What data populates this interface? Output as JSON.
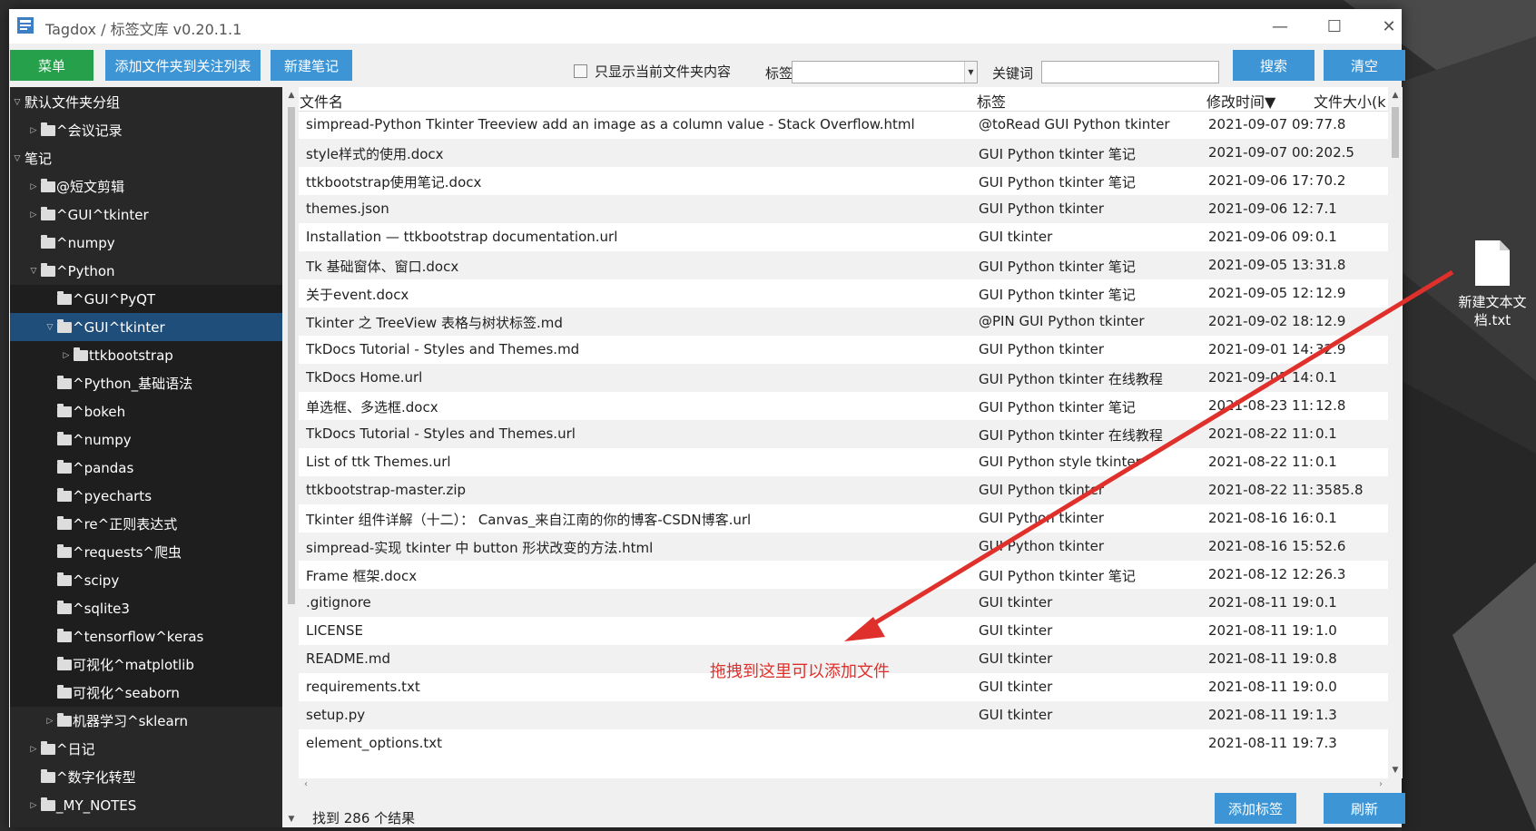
{
  "window": {
    "title": "Tagdox / 标签文库 v0.20.1.1",
    "controls": {
      "minimize": "—",
      "maximize": "☐",
      "close": "✕"
    }
  },
  "toolbar": {
    "menu": "菜单",
    "add_folder": "添加文件夹到关注列表",
    "new_note": "新建笔记",
    "only_current_folder": "只显示当前文件夹内容",
    "only_current_folder_checked": false,
    "tag_label": "标签",
    "tag_value": "",
    "keyword_label": "关键词",
    "keyword_value": "",
    "search": "搜索",
    "clear": "清空"
  },
  "tree": [
    {
      "label": "默认文件夹分组",
      "level": 0,
      "toggle": "open",
      "folder": false
    },
    {
      "label": "^会议记录",
      "level": 2,
      "toggle": "closed",
      "folder": true
    },
    {
      "label": "笔记",
      "level": 0,
      "toggle": "open",
      "folder": false
    },
    {
      "label": "@短文剪辑",
      "level": 2,
      "toggle": "closed",
      "folder": true
    },
    {
      "label": "^GUI^tkinter",
      "level": 2,
      "toggle": "closed",
      "folder": true
    },
    {
      "label": "^numpy",
      "level": 2,
      "toggle": "none",
      "folder": true
    },
    {
      "label": "^Python",
      "level": 2,
      "toggle": "open",
      "folder": true
    },
    {
      "label": "^GUI^PyQT",
      "level": 4,
      "toggle": "none",
      "folder": true
    },
    {
      "label": "^GUI^tkinter",
      "level": 4,
      "toggle": "open",
      "folder": true,
      "selected": true
    },
    {
      "label": "ttkbootstrap",
      "level": 6,
      "toggle": "closed",
      "folder": true
    },
    {
      "label": "^Python_基础语法",
      "level": 4,
      "toggle": "none",
      "folder": true
    },
    {
      "label": "^bokeh",
      "level": 4,
      "toggle": "none",
      "folder": true
    },
    {
      "label": "^numpy",
      "level": 4,
      "toggle": "none",
      "folder": true
    },
    {
      "label": "^pandas",
      "level": 4,
      "toggle": "none",
      "folder": true
    },
    {
      "label": "^pyecharts",
      "level": 4,
      "toggle": "none",
      "folder": true
    },
    {
      "label": "^re^正则表达式",
      "level": 4,
      "toggle": "none",
      "folder": true
    },
    {
      "label": "^requests^爬虫",
      "level": 4,
      "toggle": "none",
      "folder": true
    },
    {
      "label": "^scipy",
      "level": 4,
      "toggle": "none",
      "folder": true
    },
    {
      "label": "^sqlite3",
      "level": 4,
      "toggle": "none",
      "folder": true
    },
    {
      "label": "^tensorflow^keras",
      "level": 4,
      "toggle": "none",
      "folder": true
    },
    {
      "label": "可视化^matplotlib",
      "level": 4,
      "toggle": "none",
      "folder": true
    },
    {
      "label": "可视化^seaborn",
      "level": 4,
      "toggle": "none",
      "folder": true
    },
    {
      "label": "机器学习^sklearn",
      "level": 4,
      "toggle": "closed",
      "folder": true
    },
    {
      "label": "^日记",
      "level": 2,
      "toggle": "closed",
      "folder": true
    },
    {
      "label": "^数字化转型",
      "level": 2,
      "toggle": "none",
      "folder": true
    },
    {
      "label": "_MY_NOTES",
      "level": 2,
      "toggle": "closed",
      "folder": true
    }
  ],
  "columns": {
    "name": "文件名",
    "tags": "标签",
    "modified": "修改时间▼",
    "size": "文件大小(k"
  },
  "files": [
    {
      "name": "simpread-Python Tkinter Treeview add an image as a column value - Stack Overflow.html",
      "tags": "@toRead GUI Python tkinter",
      "modified": "2021-09-07 09:",
      "size": "77.8"
    },
    {
      "name": "style样式的使用.docx",
      "tags": "GUI Python tkinter 笔记",
      "modified": "2021-09-07 00:",
      "size": "202.5"
    },
    {
      "name": "ttkbootstrap使用笔记.docx",
      "tags": "GUI Python tkinter 笔记",
      "modified": "2021-09-06 17:",
      "size": "70.2"
    },
    {
      "name": "themes.json",
      "tags": "GUI Python tkinter",
      "modified": "2021-09-06 12:",
      "size": "7.1"
    },
    {
      "name": "Installation — ttkbootstrap documentation.url",
      "tags": "GUI tkinter",
      "modified": "2021-09-06 09:",
      "size": "0.1"
    },
    {
      "name": "Tk 基础窗体、窗口.docx",
      "tags": "GUI Python tkinter 笔记",
      "modified": "2021-09-05 13:",
      "size": "31.8"
    },
    {
      "name": "关于event.docx",
      "tags": "GUI Python tkinter 笔记",
      "modified": "2021-09-05 12:",
      "size": "12.9"
    },
    {
      "name": "Tkinter 之 TreeView 表格与树状标签.md",
      "tags": "@PIN GUI Python tkinter",
      "modified": "2021-09-02 18:",
      "size": "12.9"
    },
    {
      "name": "TkDocs Tutorial - Styles and Themes.md",
      "tags": "GUI Python tkinter",
      "modified": "2021-09-01 14:",
      "size": "32.9"
    },
    {
      "name": "TkDocs Home.url",
      "tags": "GUI Python tkinter 在线教程",
      "modified": "2021-09-01 14:",
      "size": "0.1"
    },
    {
      "name": "单选框、多选框.docx",
      "tags": "GUI Python tkinter 笔记",
      "modified": "2021-08-23 11:",
      "size": "12.8"
    },
    {
      "name": "TkDocs Tutorial - Styles and Themes.url",
      "tags": "GUI Python tkinter 在线教程",
      "modified": "2021-08-22 11:",
      "size": "0.1"
    },
    {
      "name": "List of ttk Themes.url",
      "tags": "GUI Python style tkinter",
      "modified": "2021-08-22 11:",
      "size": "0.1"
    },
    {
      "name": "ttkbootstrap-master.zip",
      "tags": "GUI Python tkinter",
      "modified": "2021-08-22 11:",
      "size": "3585.8"
    },
    {
      "name": "Tkinter 组件详解（十二）： Canvas_来自江南的你的博客-CSDN博客.url",
      "tags": "GUI Python tkinter",
      "modified": "2021-08-16 16:",
      "size": "0.1"
    },
    {
      "name": "simpread-实现 tkinter 中 button 形状改变的方法.html",
      "tags": "GUI Python tkinter",
      "modified": "2021-08-16 15:",
      "size": "52.6"
    },
    {
      "name": "Frame 框架.docx",
      "tags": "GUI Python tkinter 笔记",
      "modified": "2021-08-12 12:",
      "size": "26.3"
    },
    {
      "name": ".gitignore",
      "tags": "GUI tkinter",
      "modified": "2021-08-11 19:",
      "size": "0.1"
    },
    {
      "name": "LICENSE",
      "tags": "GUI tkinter",
      "modified": "2021-08-11 19:",
      "size": "1.0"
    },
    {
      "name": "README.md",
      "tags": "GUI tkinter",
      "modified": "2021-08-11 19:",
      "size": "0.8"
    },
    {
      "name": "requirements.txt",
      "tags": "GUI tkinter",
      "modified": "2021-08-11 19:",
      "size": "0.0"
    },
    {
      "name": "setup.py",
      "tags": "GUI tkinter",
      "modified": "2021-08-11 19:",
      "size": "1.3"
    },
    {
      "name": "element_options.txt",
      "tags": "",
      "modified": "2021-08-11 19:",
      "size": "7.3"
    }
  ],
  "status": {
    "result_count": "找到 286 个结果",
    "add_tag": "添加标签",
    "refresh": "刷新"
  },
  "annotation": {
    "text": "拖拽到这里可以添加文件",
    "color": "#e0302b"
  },
  "desktop": {
    "file_label_line1": "新建文本文",
    "file_label_line2": "档.txt"
  },
  "colors": {
    "green_button": "#27a04b",
    "blue_button": "#3d95d6",
    "tree_bg": "#282828",
    "tree_selected": "#1f4e7a"
  }
}
